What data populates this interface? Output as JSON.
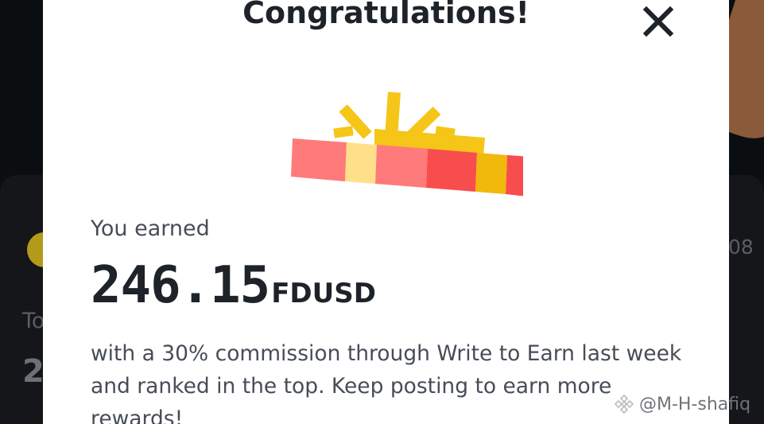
{
  "modal": {
    "title": "Congratulations!",
    "earned_label": "You earned",
    "amount": "246.15",
    "currency": "FDUSD",
    "message": "with a 30% commission through Write to Earn last week and ranked in the top. Keep posting to earn more rewards!"
  },
  "icons": {
    "close": "close-icon",
    "gift": "gift-icon",
    "watermark_logo": "binance-logo-icon"
  },
  "background": {
    "left_partial_1": "To",
    "left_partial_2": "2",
    "right_partial": "08"
  },
  "watermark": {
    "text": "@M-H-shafiq"
  },
  "colors": {
    "text_primary": "#1e2329",
    "text_secondary": "#474d57",
    "gift_red": "#f84d4d",
    "gift_pink": "#ff7a7a",
    "gift_yellow": "#f0b90b",
    "gift_light_yellow": "#ffe08a"
  }
}
